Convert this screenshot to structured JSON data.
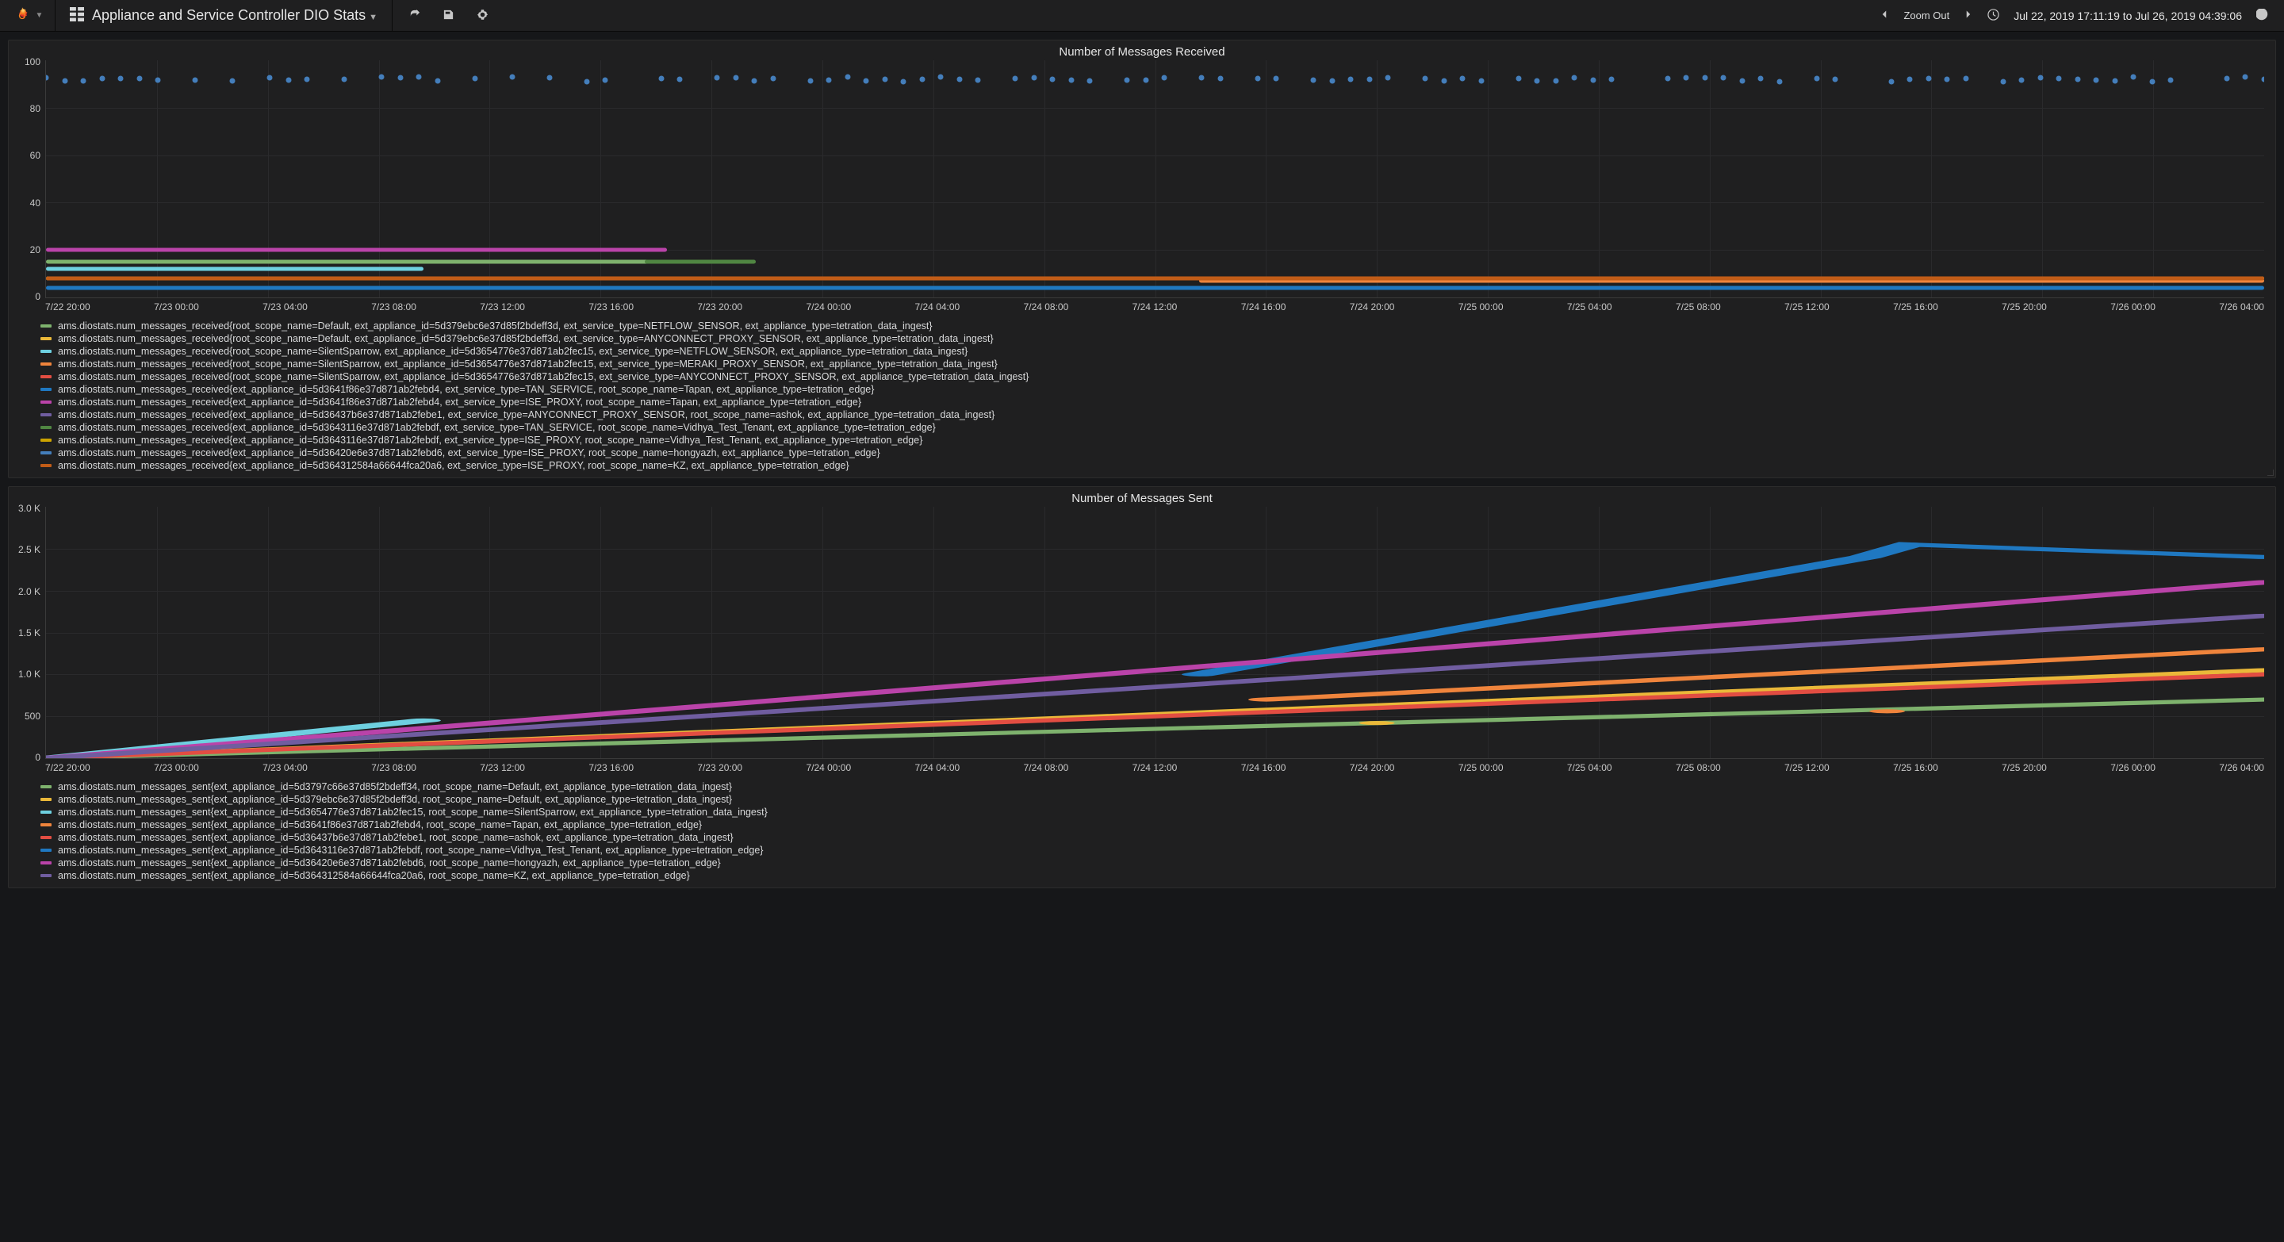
{
  "header": {
    "title": "Appliance and Service Controller DIO Stats",
    "zoom_label": "Zoom Out",
    "time_range": "Jul 22, 2019 17:11:19 to Jul 26, 2019 04:39:06"
  },
  "palette": {
    "green": "#7eb26d",
    "yellow": "#eab839",
    "teal": "#6ed0e0",
    "orange": "#ef843c",
    "red": "#e24d42",
    "blue": "#1f78c1",
    "magenta": "#ba43a9",
    "purple": "#705da0",
    "dkgreen": "#508642",
    "dkyellow": "#cca300",
    "dkteal": "#447ebb",
    "dkorange": "#c15c17"
  },
  "xaxis_labels": [
    "7/22 20:00",
    "7/23 00:00",
    "7/23 04:00",
    "7/23 08:00",
    "7/23 12:00",
    "7/23 16:00",
    "7/23 20:00",
    "7/24 00:00",
    "7/24 04:00",
    "7/24 08:00",
    "7/24 12:00",
    "7/24 16:00",
    "7/24 20:00",
    "7/25 00:00",
    "7/25 04:00",
    "7/25 08:00",
    "7/25 12:00",
    "7/25 16:00",
    "7/25 20:00",
    "7/26 00:00",
    "7/26 04:00"
  ],
  "panels": [
    {
      "title": "Number of Messages Received",
      "ylim": [
        0,
        100
      ],
      "yticks": [
        "100",
        "80",
        "60",
        "40",
        "20",
        "0"
      ],
      "legend": [
        {
          "color": "green",
          "label": "ams.diostats.num_messages_received{root_scope_name=Default, ext_appliance_id=5d379ebc6e37d85f2bdeff3d, ext_service_type=NETFLOW_SENSOR, ext_appliance_type=tetration_data_ingest}"
        },
        {
          "color": "yellow",
          "label": "ams.diostats.num_messages_received{root_scope_name=Default, ext_appliance_id=5d379ebc6e37d85f2bdeff3d, ext_service_type=ANYCONNECT_PROXY_SENSOR, ext_appliance_type=tetration_data_ingest}"
        },
        {
          "color": "teal",
          "label": "ams.diostats.num_messages_received{root_scope_name=SilentSparrow, ext_appliance_id=5d3654776e37d871ab2fec15, ext_service_type=NETFLOW_SENSOR, ext_appliance_type=tetration_data_ingest}"
        },
        {
          "color": "orange",
          "label": "ams.diostats.num_messages_received{root_scope_name=SilentSparrow, ext_appliance_id=5d3654776e37d871ab2fec15, ext_service_type=MERAKI_PROXY_SENSOR, ext_appliance_type=tetration_data_ingest}"
        },
        {
          "color": "red",
          "label": "ams.diostats.num_messages_received{root_scope_name=SilentSparrow, ext_appliance_id=5d3654776e37d871ab2fec15, ext_service_type=ANYCONNECT_PROXY_SENSOR, ext_appliance_type=tetration_data_ingest}"
        },
        {
          "color": "blue",
          "label": "ams.diostats.num_messages_received{ext_appliance_id=5d3641f86e37d871ab2febd4, ext_service_type=TAN_SERVICE, root_scope_name=Tapan, ext_appliance_type=tetration_edge}"
        },
        {
          "color": "magenta",
          "label": "ams.diostats.num_messages_received{ext_appliance_id=5d3641f86e37d871ab2febd4, ext_service_type=ISE_PROXY, root_scope_name=Tapan, ext_appliance_type=tetration_edge}"
        },
        {
          "color": "purple",
          "label": "ams.diostats.num_messages_received{ext_appliance_id=5d36437b6e37d871ab2febe1, ext_service_type=ANYCONNECT_PROXY_SENSOR, root_scope_name=ashok, ext_appliance_type=tetration_data_ingest}"
        },
        {
          "color": "dkgreen",
          "label": "ams.diostats.num_messages_received{ext_appliance_id=5d3643116e37d871ab2febdf, ext_service_type=TAN_SERVICE, root_scope_name=Vidhya_Test_Tenant, ext_appliance_type=tetration_edge}"
        },
        {
          "color": "dkyellow",
          "label": "ams.diostats.num_messages_received{ext_appliance_id=5d3643116e37d871ab2febdf, ext_service_type=ISE_PROXY, root_scope_name=Vidhya_Test_Tenant, ext_appliance_type=tetration_edge}"
        },
        {
          "color": "dkteal",
          "label": "ams.diostats.num_messages_received{ext_appliance_id=5d36420e6e37d871ab2febd6, ext_service_type=ISE_PROXY, root_scope_name=hongyazh, ext_appliance_type=tetration_edge}"
        },
        {
          "color": "dkorange",
          "label": "ams.diostats.num_messages_received{ext_appliance_id=5d364312584a66644fca20a6, ext_service_type=ISE_PROXY, root_scope_name=KZ, ext_appliance_type=tetration_edge}"
        }
      ]
    },
    {
      "title": "Number of Messages Sent",
      "ylim": [
        0,
        3000
      ],
      "yticks": [
        "3.0 K",
        "2.5 K",
        "2.0 K",
        "1.5 K",
        "1.0 K",
        "500",
        "0"
      ],
      "legend": [
        {
          "color": "green",
          "label": "ams.diostats.num_messages_sent{ext_appliance_id=5d3797c66e37d85f2bdeff34, root_scope_name=Default, ext_appliance_type=tetration_data_ingest}"
        },
        {
          "color": "yellow",
          "label": "ams.diostats.num_messages_sent{ext_appliance_id=5d379ebc6e37d85f2bdeff3d, root_scope_name=Default, ext_appliance_type=tetration_data_ingest}"
        },
        {
          "color": "teal",
          "label": "ams.diostats.num_messages_sent{ext_appliance_id=5d3654776e37d871ab2fec15, root_scope_name=SilentSparrow, ext_appliance_type=tetration_data_ingest}"
        },
        {
          "color": "orange",
          "label": "ams.diostats.num_messages_sent{ext_appliance_id=5d3641f86e37d871ab2febd4, root_scope_name=Tapan, ext_appliance_type=tetration_edge}"
        },
        {
          "color": "red",
          "label": "ams.diostats.num_messages_sent{ext_appliance_id=5d36437b6e37d871ab2febe1, root_scope_name=ashok, ext_appliance_type=tetration_data_ingest}"
        },
        {
          "color": "blue",
          "label": "ams.diostats.num_messages_sent{ext_appliance_id=5d3643116e37d871ab2febdf, root_scope_name=Vidhya_Test_Tenant, ext_appliance_type=tetration_edge}"
        },
        {
          "color": "magenta",
          "label": "ams.diostats.num_messages_sent{ext_appliance_id=5d36420e6e37d871ab2febd6, root_scope_name=hongyazh, ext_appliance_type=tetration_edge}"
        },
        {
          "color": "purple",
          "label": "ams.diostats.num_messages_sent{ext_appliance_id=5d364312584a66644fca20a6, root_scope_name=KZ, ext_appliance_type=tetration_edge}"
        }
      ]
    }
  ],
  "chart_data": [
    {
      "type": "line",
      "title": "Number of Messages Received",
      "xlabel": "",
      "ylabel": "",
      "ylim": [
        0,
        100
      ],
      "x_range": [
        "2019-07-22 17:11:19",
        "2019-07-26 04:39:06"
      ],
      "note": "Top scatter series ≈ constant 92; several overlapping low bands near 0–20",
      "series": [
        {
          "name": "Default NETFLOW_SENSOR",
          "color": "green",
          "approx_value": 15,
          "span_pct": [
            0,
            30
          ]
        },
        {
          "name": "Default ANYCONNECT_PROXY_SENSOR",
          "color": "yellow",
          "approx_value": 8,
          "span_pct": [
            0,
            100
          ]
        },
        {
          "name": "SilentSparrow NETFLOW_SENSOR",
          "color": "teal",
          "approx_value": 12,
          "span_pct": [
            0,
            17
          ]
        },
        {
          "name": "SilentSparrow MERAKI_PROXY_SENSOR",
          "color": "orange",
          "approx_value": 7,
          "span_pct": [
            52,
            100
          ]
        },
        {
          "name": "SilentSparrow ANYCONNECT_PROXY_SENSOR",
          "color": "red",
          "approx_value": 8,
          "span_pct": [
            0,
            100
          ]
        },
        {
          "name": "Tapan TAN_SERVICE",
          "color": "blue",
          "approx_value": 4,
          "span_pct": [
            0,
            100
          ]
        },
        {
          "name": "Tapan ISE_PROXY",
          "color": "magenta",
          "approx_value": 20,
          "span_pct": [
            0,
            28
          ]
        },
        {
          "name": "ashok ANYCONNECT_PROXY_SENSOR",
          "color": "purple",
          "approx_value": 8,
          "span_pct": [
            0,
            100
          ]
        },
        {
          "name": "Vidhya TAN_SERVICE",
          "color": "dkgreen",
          "approx_value": 15,
          "span_pct": [
            27,
            32
          ]
        },
        {
          "name": "Vidhya ISE_PROXY",
          "color": "dkyellow",
          "approx_value": 8,
          "span_pct": [
            0,
            100
          ]
        },
        {
          "name": "hongyazh ISE_PROXY (scatter ≈92)",
          "color": "dkteal",
          "approx_value": 92,
          "span_pct": [
            0,
            100
          ]
        },
        {
          "name": "KZ ISE_PROXY",
          "color": "dkorange",
          "approx_value": 8,
          "span_pct": [
            0,
            100
          ]
        }
      ]
    },
    {
      "type": "line",
      "title": "Number of Messages Sent",
      "xlabel": "",
      "ylabel": "",
      "ylim": [
        0,
        3000
      ],
      "x_range": [
        "2019-07-22 17:11:19",
        "2019-07-26 04:39:06"
      ],
      "note": "Cumulative-style monotone lines; values estimated from gridlines",
      "series": [
        {
          "name": "Default 5d3797c66e…ff34",
          "color": "green",
          "points": [
            [
              0,
              0
            ],
            [
              100,
              700
            ]
          ]
        },
        {
          "name": "Default 5d379ebc6e…ff3d",
          "color": "yellow",
          "points": [
            [
              0,
              0
            ],
            [
              100,
              1050
            ]
          ]
        },
        {
          "name": "SilentSparrow",
          "color": "teal",
          "points": [
            [
              0,
              0
            ],
            [
              17,
              450
            ]
          ]
        },
        {
          "name": "Tapan",
          "color": "orange",
          "points": [
            [
              55,
              700
            ],
            [
              100,
              1300
            ]
          ]
        },
        {
          "name": "ashok",
          "color": "red",
          "points": [
            [
              0,
              0
            ],
            [
              100,
              1000
            ]
          ]
        },
        {
          "name": "Vidhya_Test_Tenant",
          "color": "blue",
          "points": [
            [
              52,
              1000
            ],
            [
              82,
              2400
            ],
            [
              84,
              2550
            ],
            [
              100,
              2400
            ]
          ]
        },
        {
          "name": "hongyazh",
          "color": "magenta",
          "points": [
            [
              0,
              0
            ],
            [
              100,
              2100
            ]
          ]
        },
        {
          "name": "KZ",
          "color": "purple",
          "points": [
            [
              0,
              0
            ],
            [
              100,
              1700
            ]
          ]
        }
      ]
    }
  ]
}
